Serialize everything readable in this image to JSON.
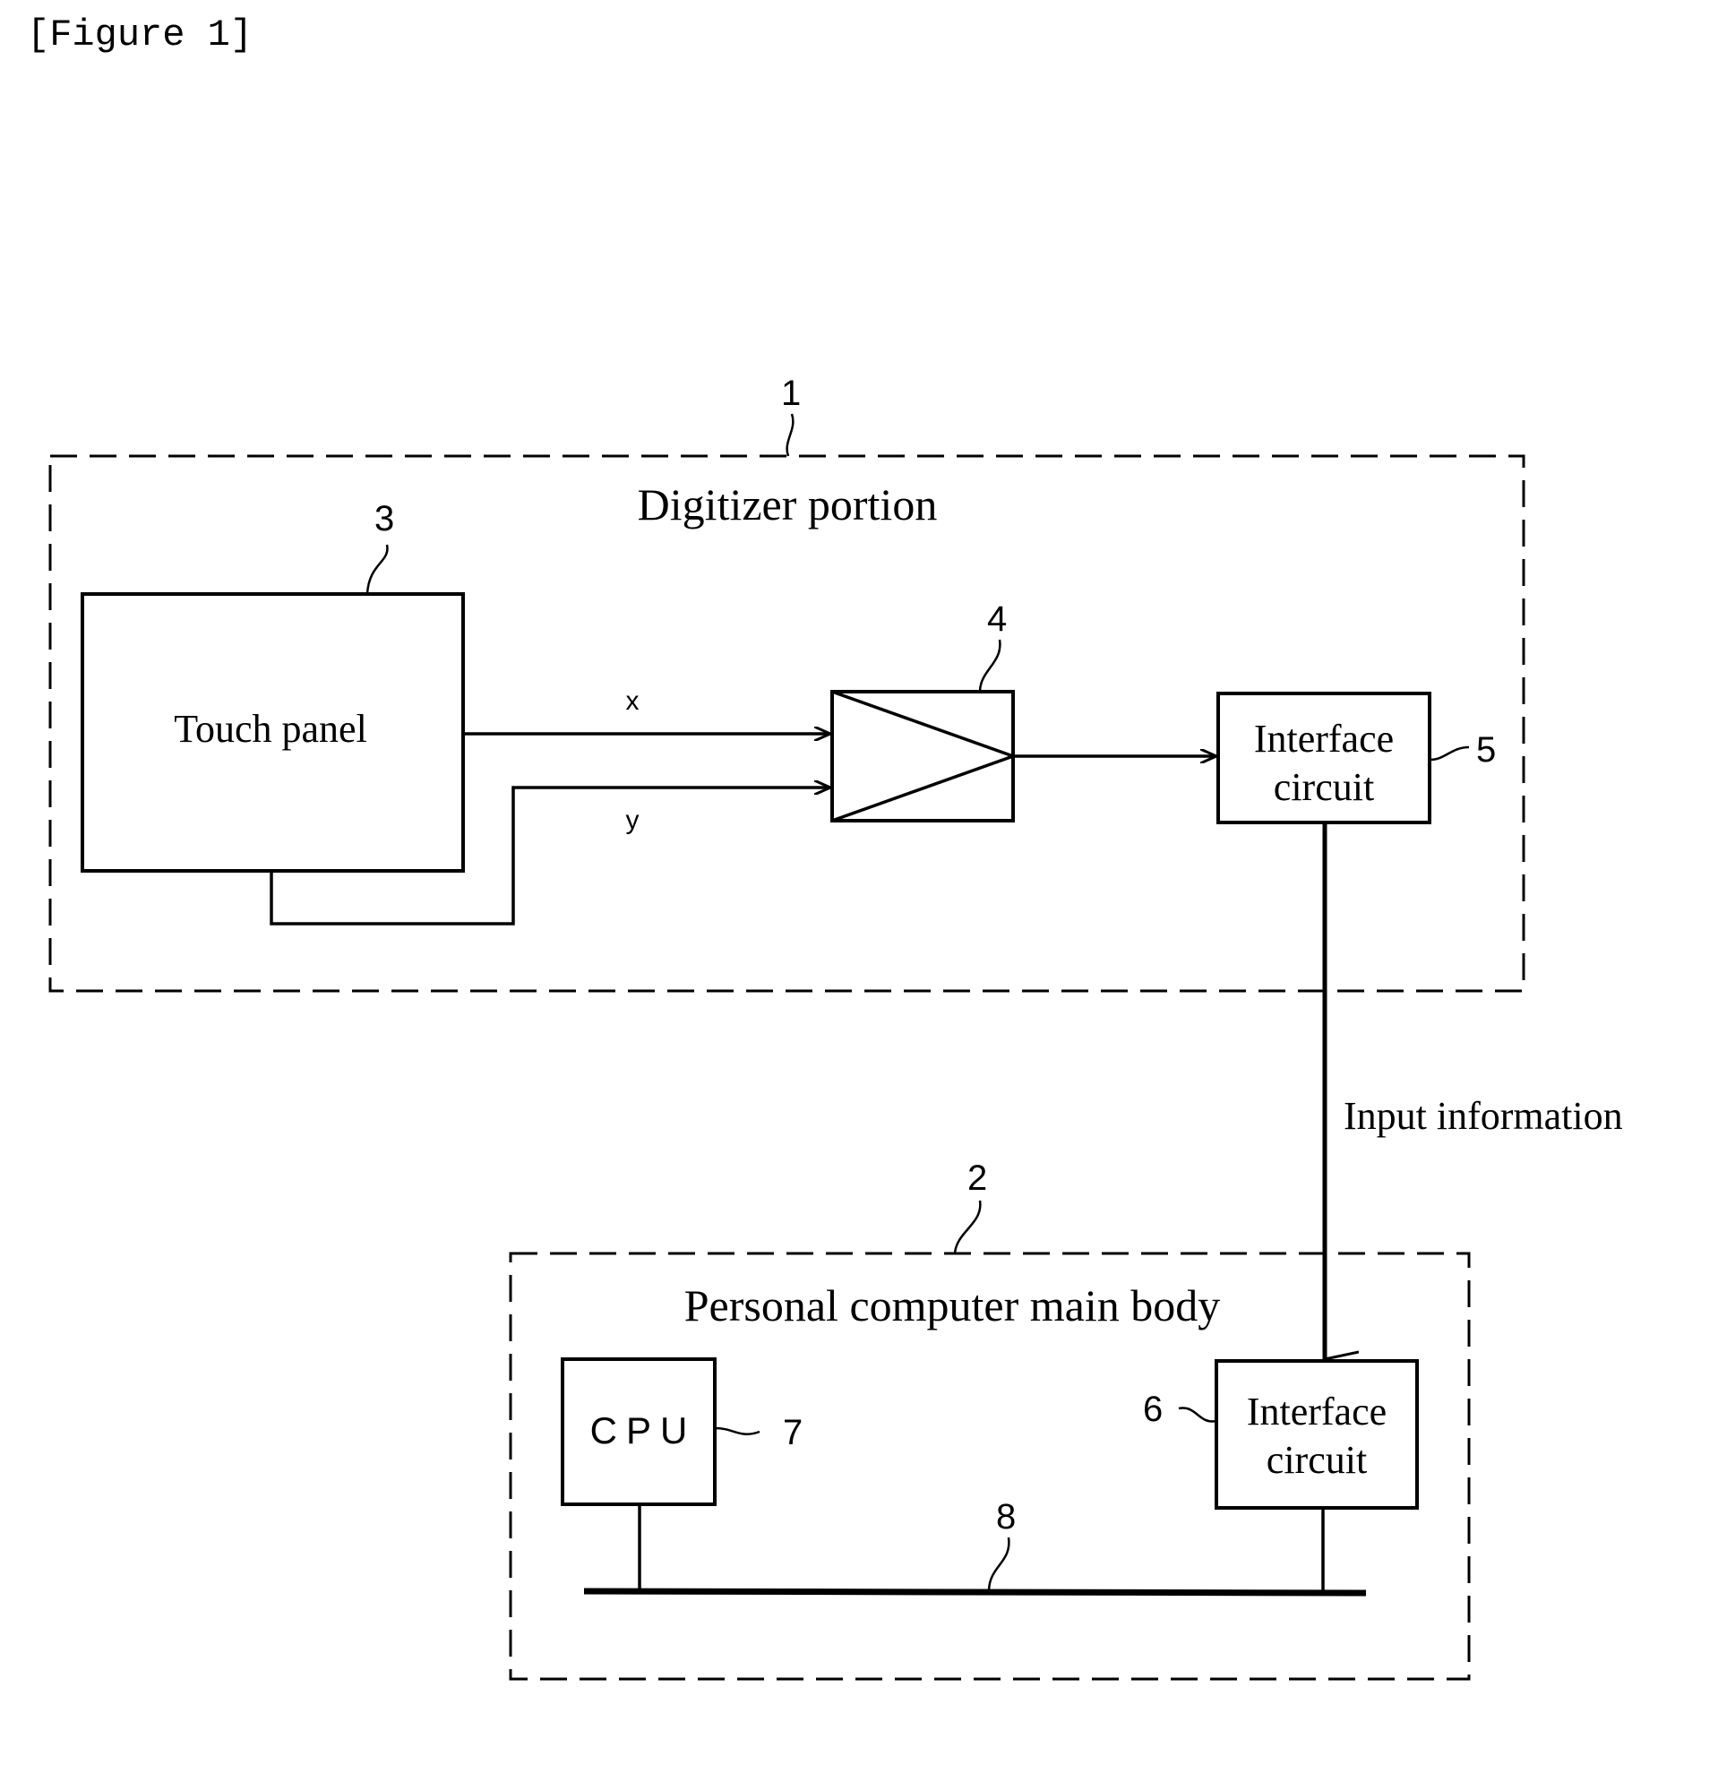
{
  "figure_label": "[Figure 1]",
  "digitizer": {
    "ref": "1",
    "title": "Digitizer portion",
    "touch_panel": {
      "ref": "3",
      "label": "Touch panel"
    },
    "signals": {
      "x": "x",
      "y": "y"
    },
    "amplifier": {
      "ref": "4"
    },
    "interface": {
      "ref": "5",
      "line1": "Interface",
      "line2": "circuit"
    }
  },
  "link_label": "Input information",
  "pc": {
    "ref": "2",
    "title": "Personal computer main body",
    "cpu": {
      "ref": "7",
      "label": "CPU"
    },
    "interface": {
      "ref": "6",
      "line1": "Interface",
      "line2": "circuit"
    },
    "bus": {
      "ref": "8"
    }
  }
}
